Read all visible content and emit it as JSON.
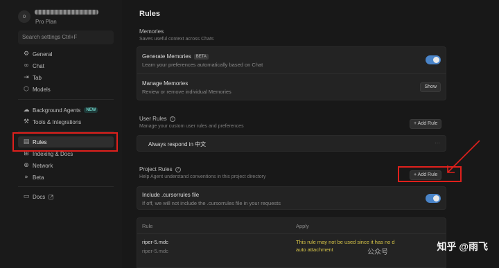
{
  "user": {
    "avatar_initial": "o",
    "plan": "Pro Plan"
  },
  "sidebar": {
    "search_placeholder": "Search settings Ctrl+F",
    "items": [
      {
        "label": "General",
        "icon": "gear-icon"
      },
      {
        "label": "Chat",
        "icon": "infinity-icon"
      },
      {
        "label": "Tab",
        "icon": "tab-arrow-icon"
      },
      {
        "label": "Models",
        "icon": "cube-icon"
      },
      {
        "label": "Background Agents",
        "icon": "cloud-icon",
        "badge": "NEW"
      },
      {
        "label": "Tools & Integrations",
        "icon": "tools-icon"
      },
      {
        "label": "Rules",
        "icon": "clipboard-icon"
      },
      {
        "label": "Indexing & Docs",
        "icon": "indexing-icon"
      },
      {
        "label": "Network",
        "icon": "globe-icon"
      },
      {
        "label": "Beta",
        "icon": "beta-icon"
      },
      {
        "label": "Docs",
        "icon": "book-icon"
      }
    ]
  },
  "main": {
    "title": "Rules",
    "memories": {
      "title": "Memories",
      "desc": "Saves useful context across Chats",
      "generate": {
        "title": "Generate Memories",
        "badge": "BETA",
        "desc": "Learn your preferences automatically based on Chat",
        "enabled": true
      },
      "manage": {
        "title": "Manage Memories",
        "desc": "Review or remove individual Memories",
        "button": "Show"
      }
    },
    "user_rules": {
      "title": "User Rules",
      "desc": "Manage your custom user rules and preferences",
      "button": "+ Add Rule",
      "items": [
        {
          "text": "Always respond in 中文",
          "menu": "···"
        }
      ]
    },
    "project_rules": {
      "title": "Project Rules",
      "desc": "Help Agent understand conventions in this project directory",
      "button": "+ Add Rule",
      "cursorrules": {
        "title": "Include .cursorrules file",
        "desc": "If off, we will not include the .cursorrules file in your requests",
        "enabled": true
      },
      "table": {
        "headers": [
          "Rule",
          "Apply"
        ],
        "rows": [
          {
            "name": "riper-5.mdc",
            "file": "riper-5.mdc",
            "apply": "This rule may not be used since it has no d",
            "apply2": "auto attachment"
          }
        ]
      }
    }
  },
  "watermark": {
    "main": "知乎 @雨飞",
    "sub": "公众号"
  },
  "colors": {
    "accent": "#4a84c8",
    "highlight": "#e0201c",
    "badge_new": "#6fd0c6",
    "warning_text": "#d8c648"
  }
}
